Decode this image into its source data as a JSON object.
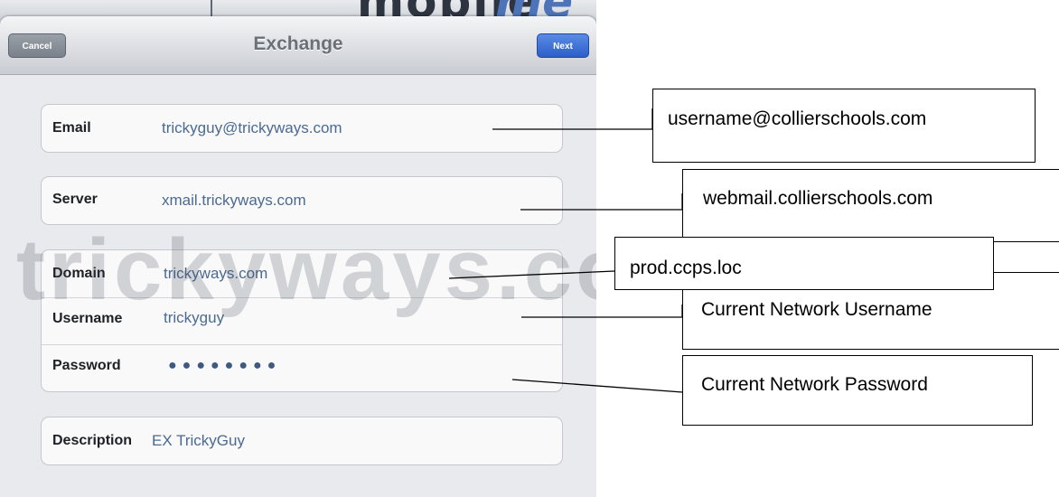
{
  "nav": {
    "title": "Exchange",
    "cancel_label": "Cancel",
    "next_label": "Next"
  },
  "watermark": "trickyways.com",
  "fields": {
    "email": {
      "label": "Email",
      "value": "trickyguy@trickyways.com"
    },
    "server": {
      "label": "Server",
      "value": "xmail.trickyways.com"
    },
    "domain": {
      "label": "Domain",
      "value": "trickyways.com"
    },
    "username": {
      "label": "Username",
      "value": "trickyguy"
    },
    "password": {
      "label": "Password",
      "value": "●●●●●●●●"
    },
    "description": {
      "label": "Description",
      "value": "EX TrickyGuy"
    }
  },
  "annotations": {
    "email": "username@collierschools.com",
    "server": "webmail.collierschools.com",
    "domain": "prod.ccps.loc",
    "username": "Current Network Username",
    "password": "Current Network Password"
  }
}
